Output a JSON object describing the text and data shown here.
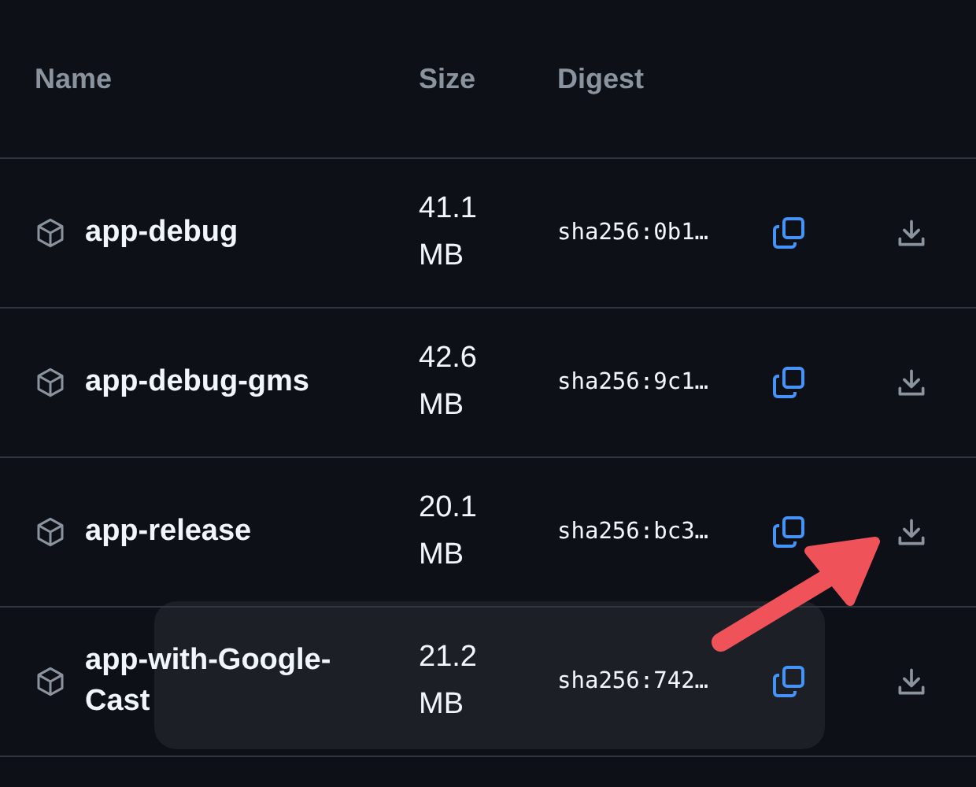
{
  "table": {
    "columns": [
      "Name",
      "Size",
      "Digest"
    ],
    "rows": [
      {
        "name": "app-debug",
        "size": "41.1 MB",
        "digest": "sha256:0b1…"
      },
      {
        "name": "app-debug-gms",
        "size": "42.6 MB",
        "digest": "sha256:9c1…"
      },
      {
        "name": "app-release",
        "size": "20.1 MB",
        "digest": "sha256:bc3…"
      },
      {
        "name": "app-with-Google-Cast",
        "size": "21.2 MB",
        "digest": "sha256:742…"
      }
    ]
  }
}
